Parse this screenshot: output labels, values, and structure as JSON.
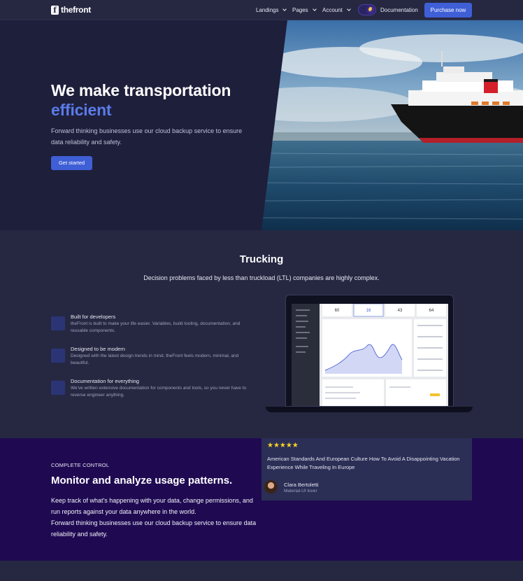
{
  "nav": {
    "logo_text": "thefront",
    "logo_mark": "f",
    "links": [
      "Landings",
      "Pages",
      "Account"
    ],
    "documentation": "Documentation",
    "purchase": "Purchase now"
  },
  "hero": {
    "title_line1": "We make transportation",
    "title_line2": "efficient",
    "lead": "Forward thinking businesses use our cloud backup service to ensure data reliability and safety.",
    "cta": "Get started"
  },
  "trucking": {
    "title": "Trucking",
    "subtitle": "Decision problems faced by less than truckload (LTL) companies are highly complex.",
    "features": [
      {
        "title": "Built for developers",
        "desc": "theFront is built to make your life easier. Variables, build tooling, documentation, and reusable components."
      },
      {
        "title": "Designed to be modern",
        "desc": "Designed with the latest design trends in mind. theFront feels modern, minimal, and beautiful."
      },
      {
        "title": "Documentation for everything",
        "desc": "We've written extensive documentation for components and tools, so you never have to reverse engineer anything."
      }
    ],
    "dashboard": {
      "stats": [
        "60",
        "16",
        "43",
        "64"
      ]
    }
  },
  "control": {
    "overline": "COMPLETE CONTROL",
    "title": "Monitor and analyze usage patterns.",
    "paragraph1": "Keep track of what's happening with your data, change permissions, and run reports against your data anywhere in the world.",
    "paragraph2": "Forward thinking businesses use our cloud backup service to ensure data reliability and safety.",
    "review": {
      "stars": "★★★★★",
      "text": "American Standards And European Culture How To Avoid A Disappointing Vacation Experience While Traveling In Europe",
      "name": "Clara Bertoletti",
      "role": "Material-UI lover"
    }
  },
  "colors": {
    "accent": "#3f5fd6",
    "accent_text": "#5b7be8",
    "star": "#f7d324",
    "hero_bg": "#1e1f3b",
    "control_bg": "#1f0a52"
  }
}
